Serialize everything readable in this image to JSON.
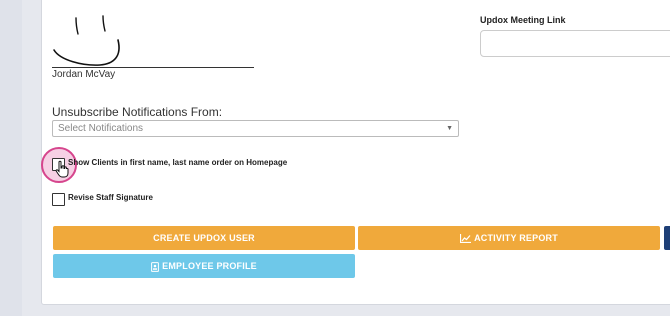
{
  "signature": {
    "name": "Jordan McVay"
  },
  "updox": {
    "meeting_link_label": "Updox Meeting Link",
    "meeting_link_value": ""
  },
  "notifications": {
    "label": "Unsubscribe Notifications From:",
    "placeholder": "Select Notifications",
    "selected": ""
  },
  "checkboxes": {
    "show_clients_label": "Show Clients in first name, last name order on Homepage",
    "show_clients_checked": false,
    "revise_signature_label": "Revise Staff Signature",
    "revise_signature_checked": false
  },
  "buttons": {
    "create_updox_user": "CREATE UPDOX USER",
    "activity_report": "ACTIVITY REPORT",
    "employee_profile": "EMPLOYEE PROFILE"
  },
  "colors": {
    "orange": "#f0a93b",
    "blue": "#6ec8e9",
    "navy": "#1e3f77",
    "highlight": "#d6458d"
  },
  "icons": {
    "activity_report": "chart-line-icon",
    "employee_profile": "id-badge-icon",
    "cursor": "hand-pointer-icon",
    "select": "caret-down-icon"
  }
}
